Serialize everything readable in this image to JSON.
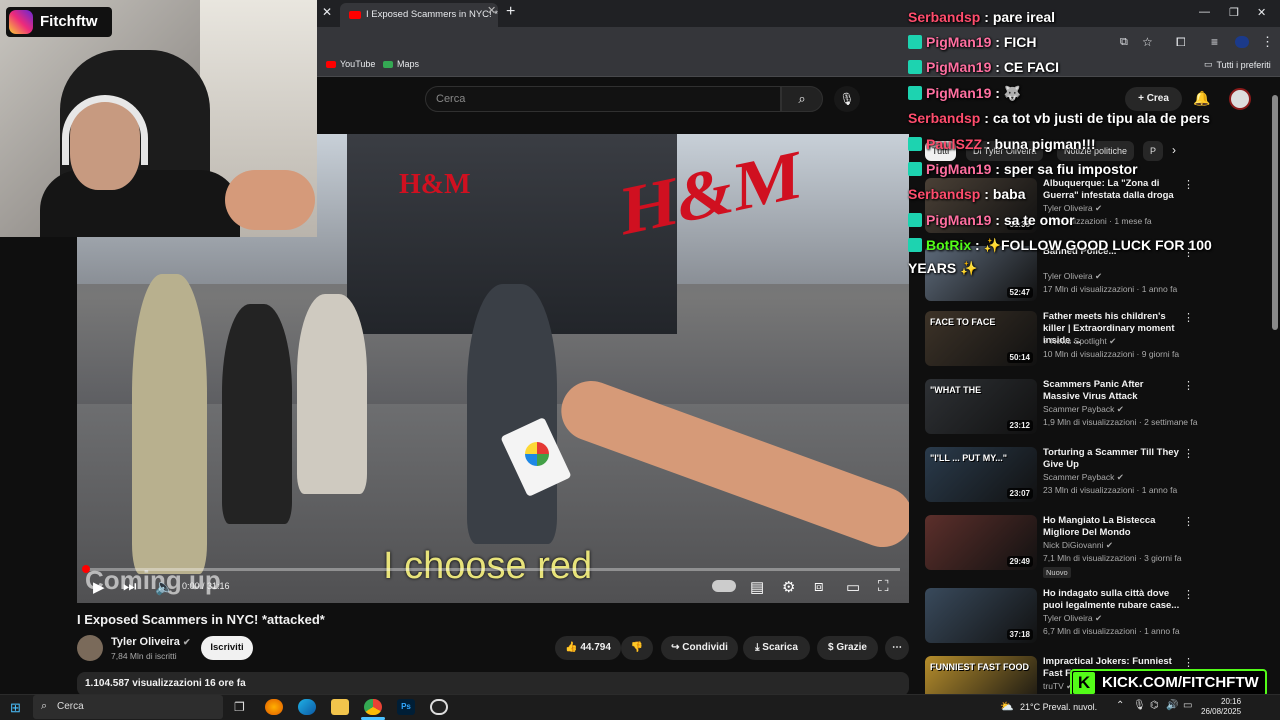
{
  "browser": {
    "tab_title": "I Exposed Scammers in NYC! *a",
    "bookmarks": [
      "YouTube",
      "Maps"
    ],
    "all_bookmarks": "Tutti i preferiti"
  },
  "youtube": {
    "search_placeholder": "Cerca",
    "create_label": "Crea",
    "video_title": "I Exposed Scammers in NYC! *attacked*",
    "channel_name": "Tyler Oliveira",
    "channel_subs": "7,84 Mln di iscritti",
    "subscribe_label": "Iscriviti",
    "likes": "44.794",
    "share_label": "Condividi",
    "download_label": "Scarica",
    "thanks_label": "Grazie",
    "description_meta": "1.104.587 visualizzazioni  16 ore fa",
    "player_time": "0:00 / 31:16",
    "player_overlay": "Coming up",
    "subtitle": "I choose red",
    "video_signs": [
      "H&M",
      "H&M"
    ],
    "filter_chips": [
      "Tutti",
      "Di Tyler Oliveira",
      "Notizie politiche",
      "P"
    ]
  },
  "recommendations": [
    {
      "title": "Albuquerque: La \"Zona di Guerra\" infestata dalla droga",
      "channel": "Tyler Oliveira",
      "meta": "... visualizzazioni · 1 mese fa",
      "duration": "31:35",
      "color": "#4a4036"
    },
    {
      "title": "Banned Police...",
      "channel": "Tyler Oliveira",
      "meta": "17 Mln di visualizzazioni · 1 anno fa",
      "duration": "52:47",
      "color": "#5d6a7a"
    },
    {
      "title": "Father meets his children's killer | Extraordinary moment inside ...",
      "channel": "7 News Spotlight",
      "meta": "10 Mln di visualizzazioni · 9 giorni fa",
      "duration": "50:14",
      "color": "#3d3328",
      "thumb_text": "FACE TO FACE"
    },
    {
      "title": "Scammers Panic After Massive Virus Attack",
      "channel": "Scammer Payback",
      "meta": "1,9 Mln di visualizzazioni · 2 settimane fa",
      "duration": "23:12",
      "color": "#2e3135",
      "thumb_text": "\"WHAT THE"
    },
    {
      "title": "Torturing a Scammer Till They Give Up",
      "channel": "Scammer Payback",
      "meta": "23 Mln di visualizzazioni · 1 anno fa",
      "duration": "23:07",
      "color": "#2a3b4c",
      "thumb_text": "\"I'LL ... PUT MY...\""
    },
    {
      "title": "Ho Mangiato La Bistecca Migliore Del Mondo",
      "channel": "Nick DiGiovanni",
      "meta": "7,1 Mln di visualizzazioni · 3 giorni fa",
      "badge": "Nuovo",
      "duration": "29:49",
      "color": "#5c2f2b"
    },
    {
      "title": "Ho indagato sulla città dove puoi legalmente rubare case...",
      "channel": "Tyler Oliveira",
      "meta": "6,7 Mln di visualizzazioni · 1 anno fa",
      "duration": "37:18",
      "color": "#394a5c"
    },
    {
      "title": "Impractical Jokers: Funniest Fast F...",
      "channel": "truTV",
      "meta": "",
      "duration": "",
      "color": "#b58d2c",
      "thumb_text": "FUNNIEST FAST FOOD"
    }
  ],
  "stream_overlay": {
    "instagram_handle": "Fitchftw",
    "kick_url": "KICK.COM/FITCHFTW",
    "chat": [
      {
        "user": "Serbandsp",
        "msg": "pare ireal",
        "badge": false,
        "style": "u"
      },
      {
        "user": "PigMan19",
        "msg": "FICH",
        "badge": true,
        "style": "u2"
      },
      {
        "user": "PigMan19",
        "msg": "CE FACI",
        "badge": true,
        "style": "u2"
      },
      {
        "user": "PigMan19",
        "msg": "🐺",
        "badge": true,
        "style": "u2"
      },
      {
        "user": "Serbandsp",
        "msg": "ca tot vb justi de tipu ala de pers",
        "badge": false,
        "style": "u"
      },
      {
        "user": "PaulSZZ",
        "msg": "buna pigman!!!",
        "badge": true,
        "style": "u"
      },
      {
        "user": "PigMan19",
        "msg": "sper sa fiu impostor",
        "badge": true,
        "style": "u2"
      },
      {
        "user": "Serbandsp",
        "msg": "baba",
        "badge": false,
        "style": "u"
      },
      {
        "user": "PigMan19",
        "msg": "sa te omor",
        "badge": true,
        "style": "u2"
      },
      {
        "user": "BotRix",
        "msg": "✨FOLLOW GOOD LUCK FOR 100",
        "badge": true,
        "style": "u3"
      },
      {
        "user": "",
        "msg": "YEARS ✨",
        "badge": false,
        "style": "u3"
      }
    ]
  },
  "taskbar": {
    "search_placeholder": "Cerca",
    "weather": "21°C  Preval. nuvol.",
    "time": "20:16",
    "date": "26/08/2025"
  }
}
